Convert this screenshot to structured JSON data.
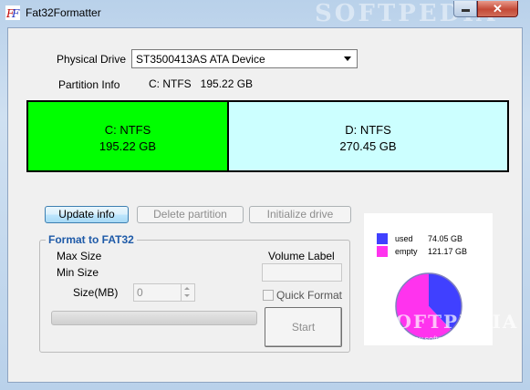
{
  "window": {
    "title": "Fat32Formatter",
    "close_glyph": "✕",
    "watermark": "SOFTPEDIA"
  },
  "physical_drive": {
    "label": "Physical Drive",
    "selected": "ST3500413AS ATA Device"
  },
  "partition_info": {
    "label": "Partition Info",
    "value": "C: NTFS   195.22 GB"
  },
  "partitions": [
    {
      "name": "C: NTFS",
      "size": "195.22 GB",
      "color": "#00ff00"
    },
    {
      "name": "D: NTFS",
      "size": "270.45 GB",
      "color": "#ccffff"
    }
  ],
  "buttons": {
    "update": "Update info",
    "delete": "Delete partition",
    "initialize": "Initialize drive"
  },
  "format": {
    "group_title": "Format to FAT32",
    "max_size_label": "Max Size",
    "min_size_label": "Min Size",
    "size_label": "Size(MB)",
    "size_value": "0",
    "volume_label_label": "Volume Label",
    "volume_label_value": "",
    "quick_format_label": "Quick Format",
    "quick_format_checked": false,
    "start_label": "Start"
  },
  "usage": {
    "used_label": "used",
    "used_value": "74.05 GB",
    "used_color": "#4040ff",
    "empty_label": "empty",
    "empty_value": "121.17 GB",
    "empty_color": "#ff33ee"
  },
  "watermark_bottom": {
    "brand": "SOFTPEDIA",
    "url": "www.softpedia.com"
  }
}
